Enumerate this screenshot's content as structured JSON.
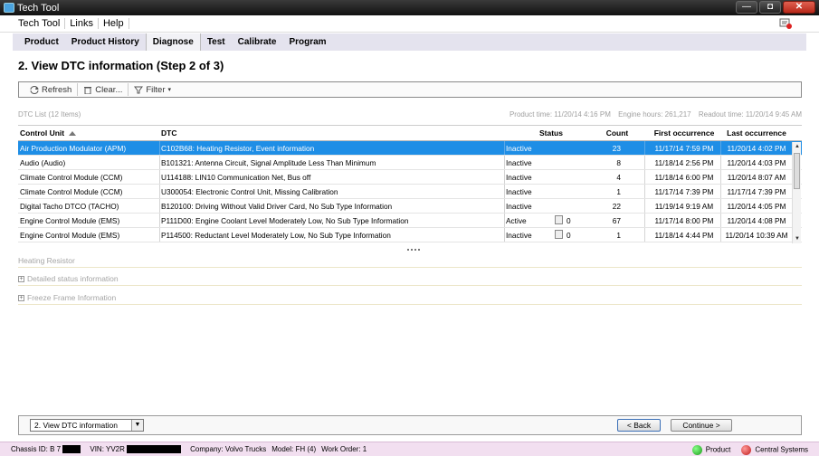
{
  "window": {
    "title": "Tech Tool",
    "minimize": "—",
    "maximize": "◘",
    "close": "✕"
  },
  "menu": [
    "Tech Tool",
    "Links",
    "Help"
  ],
  "tabs": [
    "Product",
    "Product History",
    "Diagnose",
    "Test",
    "Calibrate",
    "Program"
  ],
  "active_tab": "Diagnose",
  "page_title": "2. View DTC information (Step 2 of 3)",
  "toolbar": {
    "refresh": "Refresh",
    "clear": "Clear...",
    "filter": "Filter"
  },
  "list": {
    "title": "DTC List (12 Items)",
    "product_time": "Product time: 11/20/14 4:16 PM",
    "engine_hours": "Engine hours: 261,217",
    "readout_time": "Readout time: 11/20/14 9:45 AM"
  },
  "columns": {
    "unit": "Control Unit",
    "dtc": "DTC",
    "status": "Status",
    "count": "Count",
    "first": "First occurrence",
    "last": "Last occurrence"
  },
  "rows": [
    {
      "unit": "Air Production Modulator (APM)",
      "dtc": "C102B68: Heating Resistor, Event information",
      "status": "Inactive",
      "freeze": "",
      "count": "23",
      "first": "11/17/14 7:59 PM",
      "last": "11/20/14 4:02 PM"
    },
    {
      "unit": "Audio (Audio)",
      "dtc": "B101321: Antenna Circuit, Signal Amplitude Less Than Minimum",
      "status": "Inactive",
      "freeze": "",
      "count": "8",
      "first": "11/18/14 2:56 PM",
      "last": "11/20/14 4:03 PM"
    },
    {
      "unit": "Climate Control Module (CCM)",
      "dtc": "U114188: LIN10 Communication Net, Bus off",
      "status": "Inactive",
      "freeze": "",
      "count": "4",
      "first": "11/18/14 6:00 PM",
      "last": "11/20/14 8:07 AM"
    },
    {
      "unit": "Climate Control Module (CCM)",
      "dtc": "U300054: Electronic Control Unit, Missing Calibration",
      "status": "Inactive",
      "freeze": "",
      "count": "1",
      "first": "11/17/14 7:39 PM",
      "last": "11/17/14 7:39 PM"
    },
    {
      "unit": "Digital Tacho DTCO (TACHO)",
      "dtc": "B120100: Driving Without Valid Driver Card, No Sub Type Information",
      "status": "Inactive",
      "freeze": "",
      "count": "22",
      "first": "11/19/14 9:19 AM",
      "last": "11/20/14 4:05 PM"
    },
    {
      "unit": "Engine Control Module (EMS)",
      "dtc": "P111D00: Engine Coolant Level Moderately Low, No Sub Type Information",
      "status": "Active",
      "freeze": "0",
      "count": "67",
      "first": "11/17/14 8:00 PM",
      "last": "11/20/14 4:08 PM"
    },
    {
      "unit": "Engine Control Module (EMS)",
      "dtc": "P114500: Reductant Level Moderately Low, No Sub Type Information",
      "status": "Inactive",
      "freeze": "0",
      "count": "1",
      "first": "11/18/14 4:44 PM",
      "last": "11/20/14 10:39 AM"
    }
  ],
  "sections": {
    "heating": "Heating Resistor",
    "detailed": "Detailed status information",
    "freeze": "Freeze Frame Information"
  },
  "footer": {
    "step": "2. View DTC information",
    "back": "< Back",
    "continue": "Continue >"
  },
  "status": {
    "chassis": "Chassis ID: B 7",
    "vin": "VIN: YV2R",
    "company": "Company: Volvo Trucks",
    "model": "Model: FH (4)",
    "work_order": "Work Order: 1",
    "product": "Product",
    "central": "Central Systems"
  },
  "colors": {
    "selection": "#1e8ee6",
    "tab_bar": "#e4e3ee",
    "status_bar": "#f2dff0"
  }
}
